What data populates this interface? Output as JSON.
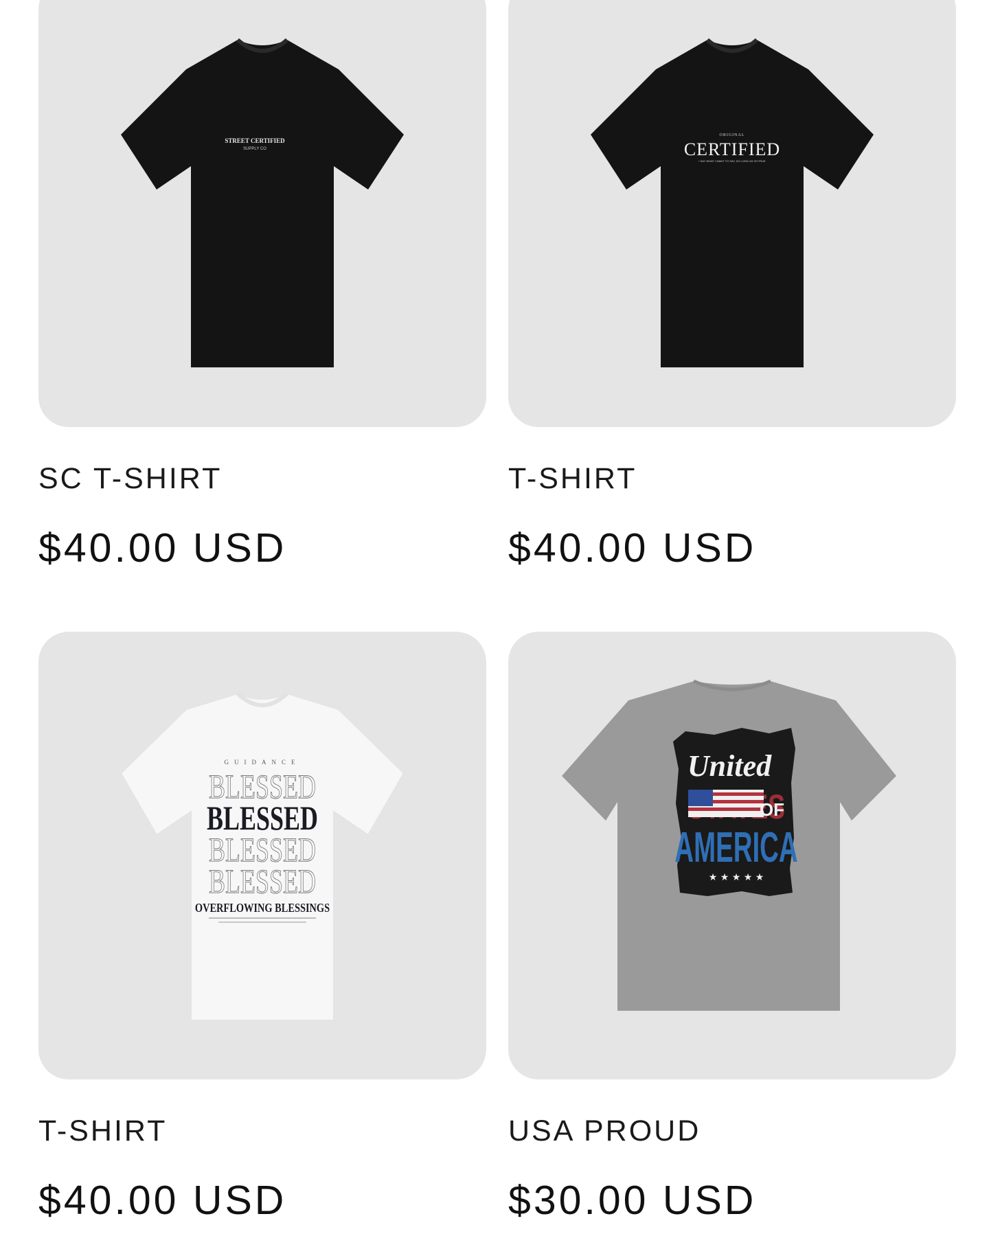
{
  "products": [
    {
      "title": "SC T-SHIRT",
      "price": "$40.00 USD",
      "shirt_color": "#141414",
      "graphic_text": [
        "STREET CERTIFIED",
        "SUPPLY CO"
      ]
    },
    {
      "title": "T-SHIRT",
      "price": "$40.00 USD",
      "shirt_color": "#141414",
      "graphic_text": [
        "ORIGINAL",
        "CERTIFIED",
        "I SAY WHAT I WANT TO SAY, DO LONG AS I'M TRUE"
      ]
    },
    {
      "title": "T-SHIRT",
      "price": "$40.00 USD",
      "shirt_color": "#f7f7f7",
      "graphic_text": [
        "GUIDANCE",
        "BLESSED",
        "BLESSED",
        "BLESSED",
        "BLESSED",
        "OVERFLOWING BLESSINGS"
      ]
    },
    {
      "title": "USA PROUD",
      "price": "$30.00 USD",
      "shirt_color": "#9a9a9a",
      "graphic_text": [
        "United",
        "STATES",
        "OF",
        "AMERICA",
        "★ ★ ★ ★ ★"
      ]
    }
  ],
  "colors": {
    "card_background": "#e5e5e6",
    "text": "#111111",
    "flag_red": "#b3323d",
    "flag_blue": "#2f6fb5"
  }
}
